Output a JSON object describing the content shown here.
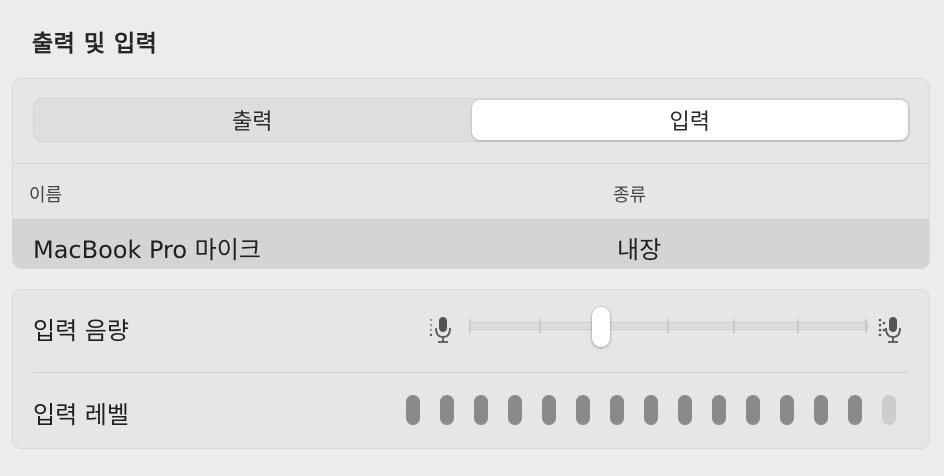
{
  "section": {
    "title": "출력 및 입력"
  },
  "tabs": [
    {
      "label": "출력",
      "active": false
    },
    {
      "label": "입력",
      "active": true
    }
  ],
  "table": {
    "columns": [
      "이름",
      "종류"
    ],
    "rows": [
      {
        "name": "MacBook Pro 마이크",
        "type": "내장",
        "selected": true
      }
    ]
  },
  "input_volume": {
    "label": "입력 음량",
    "value_fraction": 0.33,
    "low_icon": "mic-low-icon",
    "high_icon": "mic-high-icon"
  },
  "input_level": {
    "label": "입력 레벨",
    "segments_total": 15,
    "segments_lit": 14
  },
  "colors": {
    "background": "#ececec",
    "panel": "#e6e6e6",
    "selected_row": "#d4d4d4",
    "meter_on": "#8a8a8a",
    "meter_off": "#cdcdcd"
  }
}
